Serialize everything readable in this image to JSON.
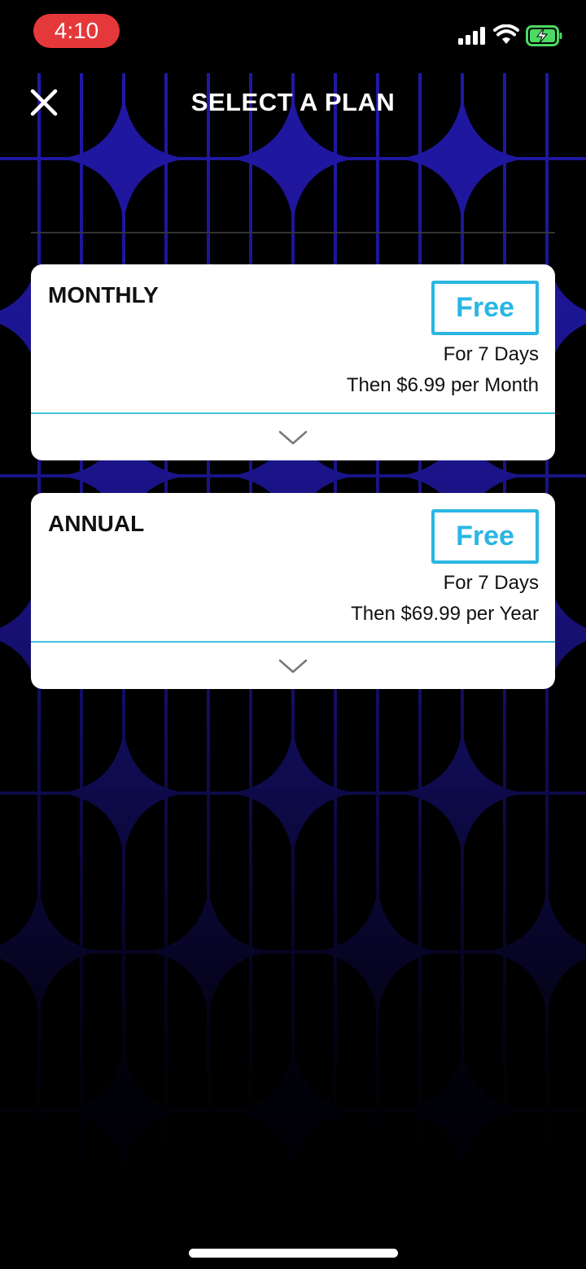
{
  "status_bar": {
    "time": "4:10",
    "time_pill_color": "#e5383b",
    "icons": [
      "signal-icon",
      "wifi-icon",
      "battery-charging-icon"
    ]
  },
  "header": {
    "title": "SELECT A PLAN",
    "close_icon": "close-icon"
  },
  "plans": [
    {
      "name": "MONTHLY",
      "badge": "Free",
      "trial": "For 7 Days",
      "price": "Then $6.99 per Month",
      "expand_icon": "chevron-down-icon"
    },
    {
      "name": "ANNUAL",
      "badge": "Free",
      "trial": "For 7 Days",
      "price": "Then $69.99 per Year",
      "expand_icon": "chevron-down-icon"
    }
  ],
  "colors": {
    "background": "#000000",
    "pattern": "#2a1fd6",
    "accent": "#29b6e3",
    "card": "#ffffff",
    "battery": "#4cd964"
  }
}
